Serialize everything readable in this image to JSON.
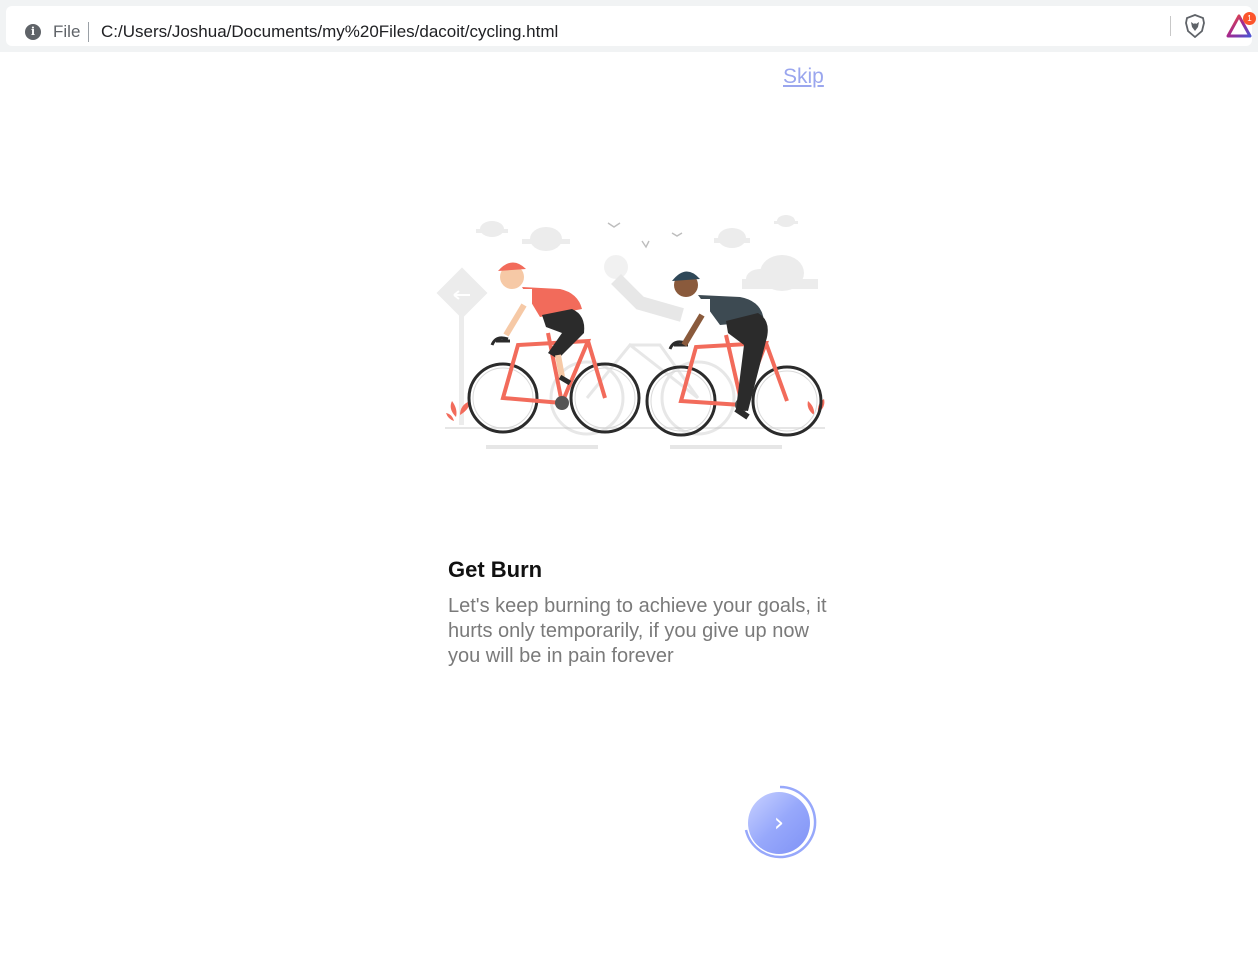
{
  "browser": {
    "scheme_label": "File",
    "url": "C:/Users/Joshua/Documents/my%20Files/dacoit/cycling.html",
    "rewards_badge_count": "1"
  },
  "onboarding": {
    "skip_label": "Skip",
    "title": "Get Burn",
    "description": "Let's keep burning to achieve your goals, it hurts only temporarily, if you give up now you will be in pain forever",
    "next_button_icon": "chevron-right-icon",
    "accent_color": "#9aa6ee",
    "title_color": "#111111",
    "description_color": "#7a7a7a"
  }
}
